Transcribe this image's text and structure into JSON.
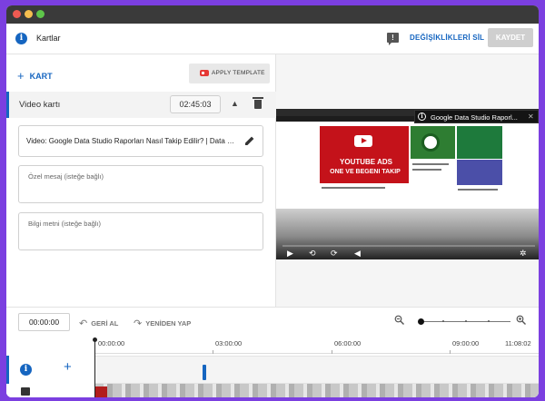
{
  "window": {
    "traffic_lights": [
      "#ee5a52",
      "#f5be4f",
      "#5ec64a"
    ]
  },
  "header": {
    "title": "Kartlar",
    "info_icon": "info-icon",
    "feedback_icon": "feedback-icon",
    "discard_label": "DEĞİŞİKLİKLERİ SİL",
    "save_label": "KAYDET"
  },
  "editor": {
    "add_card_label": "KART",
    "apply_template_label": "APPLY TEMPLATE",
    "card": {
      "title": "Video kartı",
      "time": "02:45:03",
      "video_value": "Video: Google Data Studio Raporları Nasıl Takip Edilir? | Data Studio",
      "custom_message_placeholder": "Özel mesaj (isteğe bağlı)",
      "teaser_placeholder": "Bilgi metni (isteğe bağlı)"
    }
  },
  "preview": {
    "card_teaser_title": "Google Data Studio Raporl...",
    "thumb_headline_1": "YOUTUBE ADS",
    "thumb_headline_2": "ONE VE BEGENI TAKIP",
    "controls": [
      "play-icon",
      "rewind-icon",
      "forward-icon",
      "volume-icon",
      "settings-icon"
    ]
  },
  "bottombar": {
    "current_time": "00:00:00",
    "undo_label": "GERİ AL",
    "redo_label": "YENİDEN YAP",
    "zoom_level": 0
  },
  "timeline": {
    "ruler": [
      "00:00:00",
      "03:00:00",
      "06:00:00",
      "09:00:00",
      "11:08:02"
    ],
    "playhead_time": "00:00:00",
    "card_marker_time": "02:45:03"
  },
  "colors": {
    "accent": "#1565c0",
    "background": "#7b3fe0",
    "titlebar": "#3a3a3a"
  }
}
